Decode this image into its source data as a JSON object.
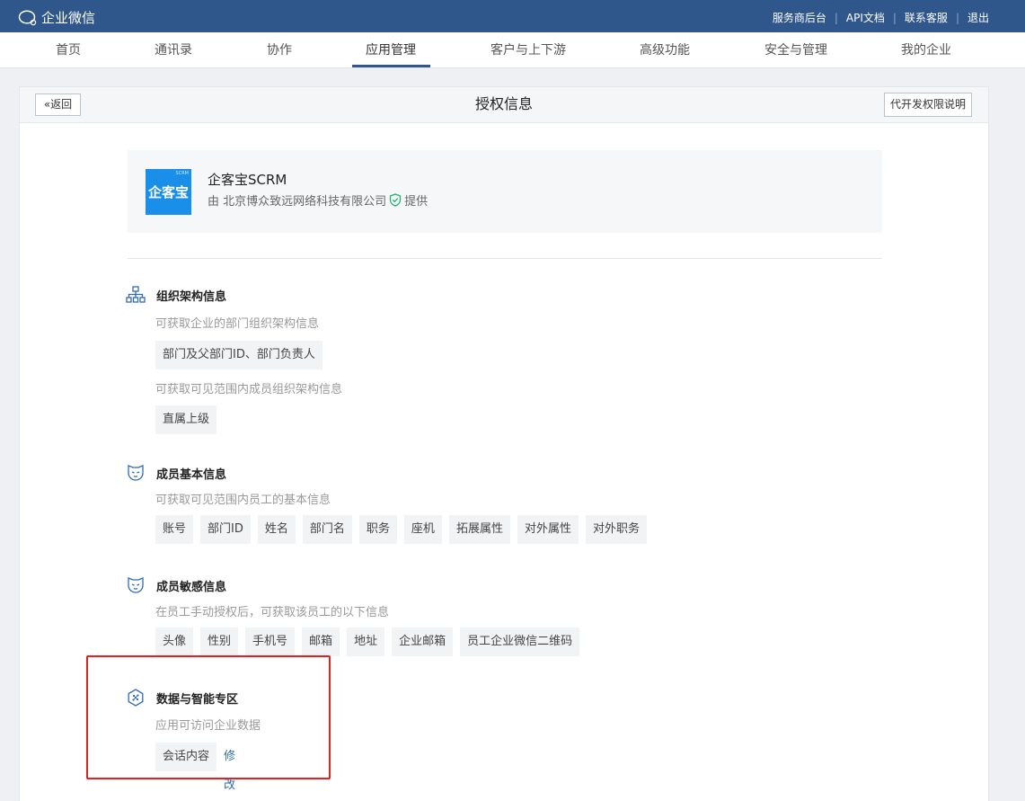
{
  "topbar": {
    "logo_text": "企业微信",
    "links": [
      "服务商后台",
      "API文档",
      "联系客服",
      "退出"
    ]
  },
  "nav": {
    "items": [
      "首页",
      "通讯录",
      "协作",
      "应用管理",
      "客户与上下游",
      "高级功能",
      "安全与管理",
      "我的企业"
    ],
    "active": "应用管理"
  },
  "header": {
    "back_label": "返回",
    "title": "授权信息",
    "perm_button_label": "代开发权限说明"
  },
  "app": {
    "icon_text": "企客宝",
    "icon_tag": "SCRM",
    "name": "企客宝SCRM",
    "provider_prefix": "由 北京博众致远网络科技有限公司",
    "provider_suffix": "提供"
  },
  "sections": {
    "org": {
      "title": "组织架构信息",
      "desc1": "可获取企业的部门组织架构信息",
      "chips1": [
        "部门及父部门ID、部门负责人"
      ],
      "desc2": "可获取可见范围内成员组织架构信息",
      "chips2": [
        "直属上级"
      ]
    },
    "basic": {
      "title": "成员基本信息",
      "desc": "可获取可见范围内员工的基本信息",
      "chips": [
        "账号",
        "部门ID",
        "姓名",
        "部门名",
        "职务",
        "座机",
        "拓展属性",
        "对外属性",
        "对外职务"
      ]
    },
    "sensitive": {
      "title": "成员敏感信息",
      "desc": "在员工手动授权后，可获取该员工的以下信息",
      "chips": [
        "头像",
        "性别",
        "手机号",
        "邮箱",
        "地址",
        "企业邮箱",
        "员工企业微信二维码"
      ]
    },
    "data": {
      "title": "数据与智能专区",
      "desc": "应用可访问企业数据",
      "chips": [
        "会话内容"
      ],
      "edit_label": "修改"
    }
  },
  "colors": {
    "topbar_bg": "#30578b",
    "accent_link": "#2f6bb3",
    "highlight_box": "#e42020"
  }
}
